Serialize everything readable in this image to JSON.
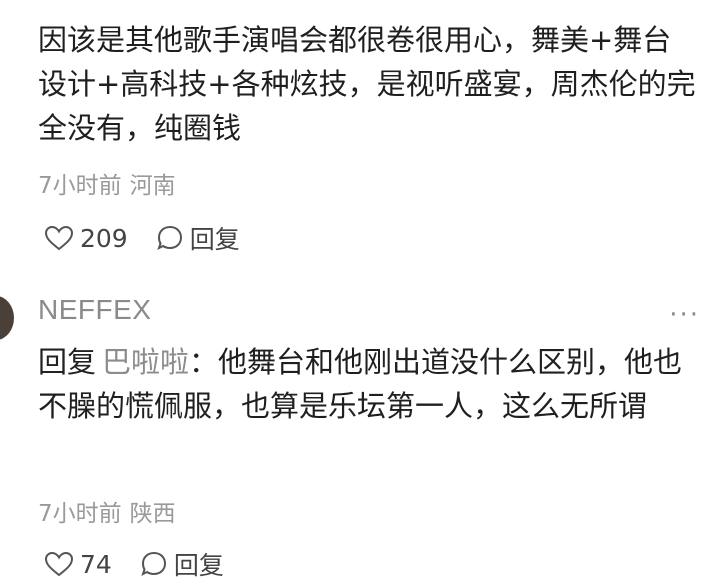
{
  "comments": [
    {
      "username": "",
      "text": "因该是其他歌手演唱会都很卷很用心，舞美+舞台设计+高科技+各种炫技，是视听盛宴，周杰伦的完全没有，纯圈钱",
      "time": "7小时前",
      "location": "河南",
      "likes": "209",
      "reply_label": "回复"
    },
    {
      "username": "NEFFEX",
      "more": "···",
      "reply_prefix": "回复",
      "reply_target": "巴啦啦",
      "colon": "：",
      "text": "他舞台和他刚出道没什么区别，他也不臊的慌佩服，也算是乐坛第一人，这么无所谓",
      "time": "7小时前",
      "location": "陕西",
      "likes": "74",
      "reply_label": "回复"
    }
  ]
}
